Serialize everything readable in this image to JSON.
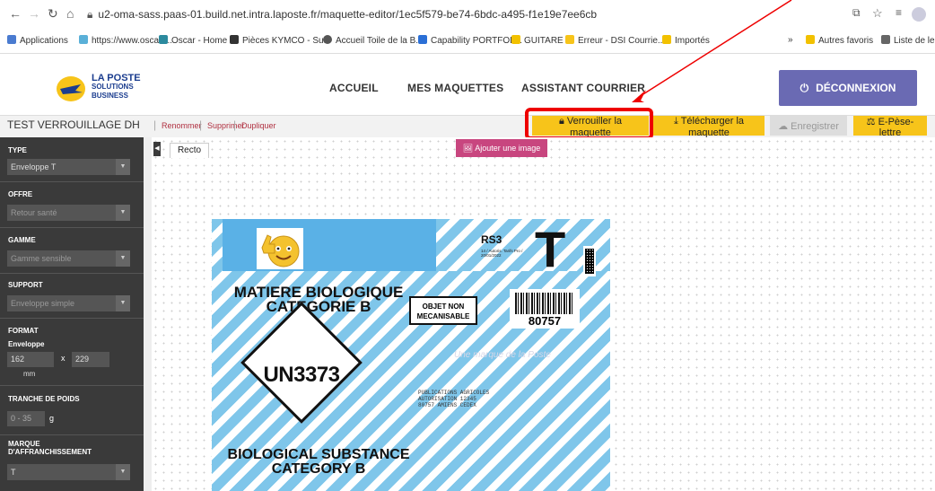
{
  "browser": {
    "address": "u2-oma-sass.paas-01.build.net.intra.laposte.fr/maquette-editor/1ec5f579-be74-6bdc-a495-f1e19e7ee6cb",
    "bookmarks": [
      "Applications",
      "https://www.oscar-...",
      "Oscar - Home",
      "Pièces KYMCO - Su...",
      "Accueil Toile de la B...",
      "Capability PORTFOL...",
      "GUITARE",
      "Erreur - DSI Courrie...",
      "Importés"
    ],
    "bookmarks_overflow": "»",
    "other_bookmarks": "Autres favoris",
    "reading_list": "Liste de lectu"
  },
  "header": {
    "logo_line1": "LA POSTE",
    "logo_line2": "SOLUTIONS",
    "logo_line3": "BUSINESS",
    "menu": [
      "ACCUEIL",
      "MES MAQUETTES",
      "ASSISTANT COURRIER"
    ],
    "logout_label": "DÉCONNEXION",
    "brand_color": "#6a6ab3"
  },
  "toolbar": {
    "doc_title": "TEST VERROUILLAGE DH",
    "rename": "Renommer",
    "delete": "Supprimer",
    "duplicate": "Dupliquer",
    "lock": "Verrouiller la maquette",
    "download": "Télécharger la maquette",
    "save": "Enregistrer",
    "scale": "E-Pèse-lettre",
    "accent": "#f7c41a"
  },
  "sidebar": {
    "type_label": "TYPE",
    "type_value": "Enveloppe T",
    "offer_label": "OFFRE",
    "offer_value": "Retour santé",
    "range_label": "GAMME",
    "range_value": "Gamme sensible",
    "support_label": "SUPPORT",
    "support_value": "Enveloppe simple",
    "format_label": "FORMAT",
    "format_sub": "Enveloppe",
    "format_width": "162",
    "format_x": "x",
    "format_height": "229",
    "format_unit": "mm",
    "weight_label": "TRANCHE DE POIDS",
    "weight_value": "0 - 35",
    "weight_unit": "g",
    "franking_label": "MARQUE D'AFFRANCHISSEMENT",
    "franking_value": "T"
  },
  "canvas": {
    "tab_recto": "Recto",
    "add_image": "Ajouter une image"
  },
  "envelope": {
    "code": "RS3",
    "small_text": "14 / Autoris. Tarifs Pro / 20/01/2022",
    "big_t": "T",
    "text_bio_fr_1": "MATIERE BIOLOGIQUE",
    "text_bio_fr_2": "CATEGORIE B",
    "objet_1": "OBJET NON",
    "objet_2": "MECANISABLE",
    "postcode": "80757",
    "un_code": "UN3373",
    "address_1": "PUBLICATIONS AGRICOLES",
    "address_2": "AUTORISATION 12345",
    "address_3": "80757 AMIENS CEDEX",
    "watermark": "Une marque de la Poste",
    "text_bio_en_1": "BIOLOGICAL SUBSTANCE",
    "text_bio_en_2": "CATEGORY B"
  }
}
